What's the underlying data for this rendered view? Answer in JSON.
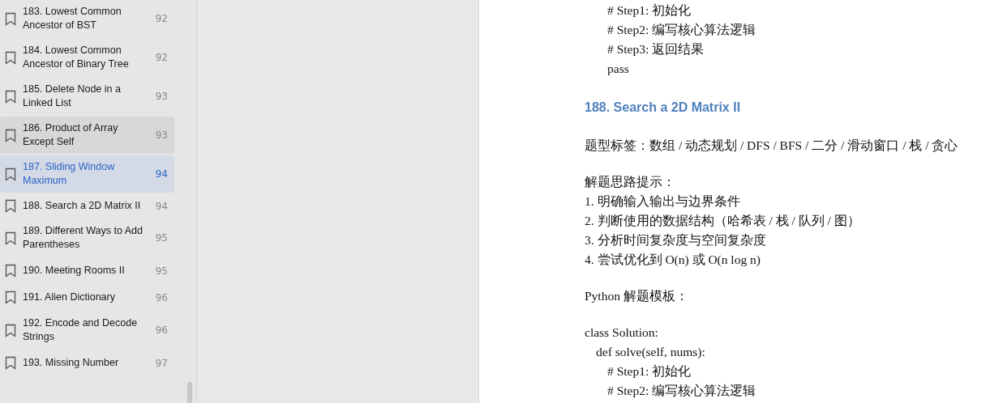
{
  "sidebar": {
    "items": [
      {
        "number": "183.",
        "title": "Lowest Common Ancestor of BST",
        "page": "92",
        "hovered": false,
        "selected": false
      },
      {
        "number": "184.",
        "title": "Lowest Common Ancestor of Binary Tree",
        "page": "92",
        "hovered": false,
        "selected": false
      },
      {
        "number": "185.",
        "title": "Delete Node in a Linked List",
        "page": "93",
        "hovered": false,
        "selected": false
      },
      {
        "number": "186.",
        "title": "Product of Array Except Self",
        "page": "93",
        "hovered": true,
        "selected": false
      },
      {
        "number": "187.",
        "title": "Sliding Window Maximum",
        "page": "94",
        "hovered": false,
        "selected": true
      },
      {
        "number": "188.",
        "title": "Search a 2D Matrix II",
        "page": "94",
        "hovered": false,
        "selected": false
      },
      {
        "number": "189.",
        "title": "Different Ways to Add Parentheses",
        "page": "95",
        "hovered": false,
        "selected": false
      },
      {
        "number": "190.",
        "title": "Meeting Rooms II",
        "page": "95",
        "hovered": false,
        "selected": false
      },
      {
        "number": "191.",
        "title": "Alien Dictionary",
        "page": "96",
        "hovered": false,
        "selected": false
      },
      {
        "number": "192.",
        "title": "Encode and Decode Strings",
        "page": "96",
        "hovered": false,
        "selected": false
      },
      {
        "number": "193.",
        "title": "Missing Number",
        "page": "97",
        "hovered": false,
        "selected": false
      }
    ]
  },
  "page": {
    "blocks": [
      {
        "kind": "code",
        "lines": [
          "# Step1: 初始化",
          "# Step2: 编写核心算法逻辑",
          "# Step3: 返回结果",
          "pass"
        ]
      },
      {
        "kind": "heading",
        "text": "188. Search a 2D Matrix II"
      },
      {
        "kind": "paragraph",
        "lines": [
          "题型标签：数组 / 动态规划 / DFS / BFS / 二分 / 滑动窗口 / 栈 / 贪心"
        ]
      },
      {
        "kind": "paragraph",
        "lines": [
          "解题思路提示：",
          "1. 明确输入输出与边界条件",
          "2. 判断使用的数据结构（哈希表 / 栈 / 队列 / 图）",
          "3. 分析时间复杂度与空间复杂度",
          "4. 尝试优化到 O(n) 或 O(n log n)"
        ]
      },
      {
        "kind": "paragraph",
        "lines": [
          "Python 解题模板："
        ]
      },
      {
        "kind": "tree",
        "nodes": [
          {
            "text": "class Solution:",
            "children": [
              {
                "text": "def solve(self, nums):",
                "children": [
                  {
                    "text": "# Step1: 初始化"
                  },
                  {
                    "text": "# Step2: 编写核心算法逻辑"
                  }
                ]
              }
            ]
          }
        ]
      }
    ]
  }
}
